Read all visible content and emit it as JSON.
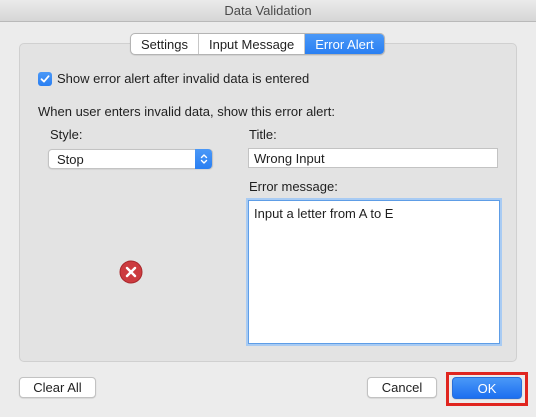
{
  "window": {
    "title": "Data Validation"
  },
  "tabs": [
    {
      "label": "Settings",
      "active": false
    },
    {
      "label": "Input Message",
      "active": false
    },
    {
      "label": "Error Alert",
      "active": true
    }
  ],
  "show_alert": {
    "label": "Show error alert after invalid data is entered",
    "checked": true
  },
  "instruction": "When user enters invalid data, show this error alert:",
  "style": {
    "label": "Style:",
    "value": "Stop",
    "icon": "stop-icon"
  },
  "title_field": {
    "label": "Title:",
    "value": "Wrong Input"
  },
  "message_field": {
    "label": "Error message:",
    "value": "Input a letter from A to E"
  },
  "buttons": {
    "clear_all": "Clear All",
    "cancel": "Cancel",
    "ok": "OK"
  },
  "colors": {
    "accent": "#2a7ff2",
    "stop_icon": "#cc3b3f",
    "highlight": "#e0251f"
  }
}
